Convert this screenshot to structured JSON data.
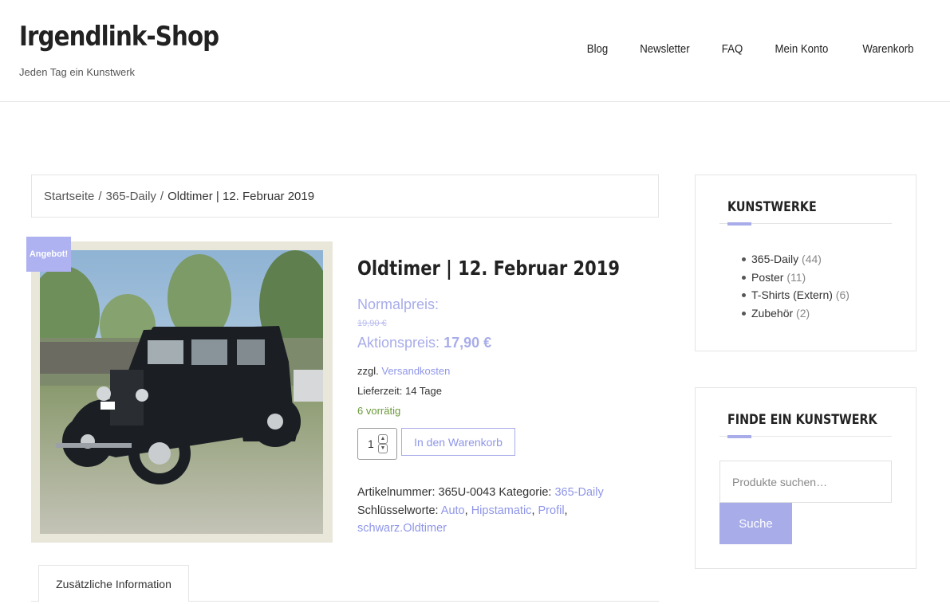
{
  "header": {
    "site_title": "Irgendlink-Shop",
    "tagline": "Jeden Tag ein Kunstwerk",
    "nav": [
      "Blog",
      "Newsletter",
      "FAQ",
      "Mein Konto",
      "Warenkorb"
    ]
  },
  "breadcrumb": {
    "home": "Startseite",
    "category": "365-Daily",
    "current": "Oldtimer | 12. Februar 2019",
    "separator": "/"
  },
  "product": {
    "sale_badge": "Angebot!",
    "title": "Oldtimer | 12. Februar 2019",
    "regular_label": "Normalpreis:",
    "old_price": "19,90 €",
    "sale_label": "Aktionspreis:",
    "sale_price": "17,90 €",
    "shipping_prefix": "zzgl.",
    "shipping_link": "Versandkosten",
    "delivery": "Lieferzeit: 14 Tage",
    "stock": "6 vorrätig",
    "quantity": "1",
    "add_to_cart": "In den Warenkorb",
    "sku_label": "Artikelnummer:",
    "sku": "365U-0043",
    "category_label": "Kategorie:",
    "category": "365-Daily",
    "tags_label": "Schlüsselworte:",
    "tags": [
      "Auto",
      "Hipstamatic",
      "Profil",
      "schwarz.Oldtimer"
    ]
  },
  "tabs": {
    "additional_info": "Zusätzliche Information"
  },
  "sidebar": {
    "categories_title": "KUNSTWERKE",
    "categories": [
      {
        "name": "365-Daily",
        "count": "(44)"
      },
      {
        "name": "Poster",
        "count": "(11)"
      },
      {
        "name": "T-Shirts (Extern)",
        "count": "(6)"
      },
      {
        "name": "Zubehör",
        "count": "(2)"
      }
    ],
    "search_title": "FINDE EIN KUNSTWERK",
    "search_placeholder": "Produkte suchen…",
    "search_button": "Suche"
  },
  "colors": {
    "accent": "#a8ace9",
    "link": "#8f96e8",
    "in_stock": "#6b9a3a"
  }
}
